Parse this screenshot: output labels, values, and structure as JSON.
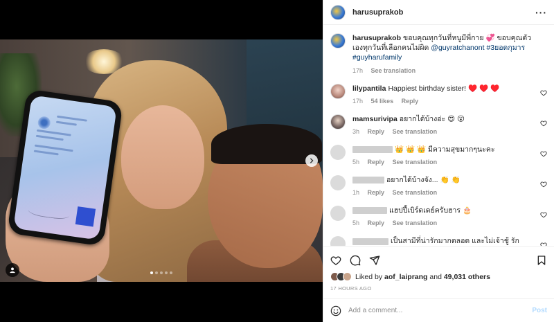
{
  "post": {
    "author": "harusuprakob",
    "caption_user": "harusuprakob",
    "caption_text": "ขอบคุณทุกวันที่หนูมีพี่กาย 💞 ขอบคุณตัวเองทุกวันที่เลือกคนไม่ผิด ",
    "caption_mention": "@guyratchanont",
    "caption_tags": " #3ยอดกุมาร #guyharufamily",
    "caption_time": "17h",
    "caption_translate": "See translation",
    "carousel_dots": 5,
    "carousel_active_index": 0,
    "likes_by": "aof_laiprang",
    "likes_connector": "Liked by",
    "likes_and": "and",
    "likes_others": "49,031 others",
    "posted_ago": "17 HOURS AGO"
  },
  "comments": [
    {
      "user": "lilypantila",
      "text": "Happiest birthday sister! ♥️ ♥️ ♥️",
      "time": "17h",
      "likes": "54 likes",
      "reply": "Reply",
      "avatar": "pink",
      "redacted": false
    },
    {
      "user": "mamsurivipa",
      "text": "อยากได้บ้างอ่ะ 😍 😮",
      "time": "3h",
      "reply": "Reply",
      "translate": "See translation",
      "avatar": "dark",
      "redacted": false
    },
    {
      "user": "",
      "text": "👑 👑 👑 มีความสุขมากๆนะคะ",
      "time": "5h",
      "reply": "Reply",
      "translate": "See translation",
      "avatar": "gray",
      "redacted": true
    },
    {
      "user": "",
      "text": "อยากได้บ้างจัง... 👏 👏",
      "time": "1h",
      "reply": "Reply",
      "translate": "See translation",
      "avatar": "gray",
      "redacted": true
    },
    {
      "user": "",
      "text": "แฮปปี้เบิร์ดเดย์ครับฮาร 🎂",
      "time": "5h",
      "reply": "Reply",
      "translate": "See translation",
      "avatar": "gray",
      "redacted": true
    },
    {
      "user": "",
      "text": "เป็นสามีที่น่ารักมากตลอด และไม่เจ้าชู้ รักครอบครัวมากๆ ครอบครัวอบอุ่น 😍 😍 😍 😍",
      "time": "",
      "reply": "",
      "translate": "",
      "avatar": "gray",
      "redacted": true
    }
  ],
  "add_comment": {
    "placeholder": "Add a comment...",
    "post_label": "Post"
  },
  "colors": {
    "link": "#00376b",
    "muted": "#8e8e8e",
    "post_disabled": "#b3dbff",
    "heart_red": "#ed4956"
  }
}
